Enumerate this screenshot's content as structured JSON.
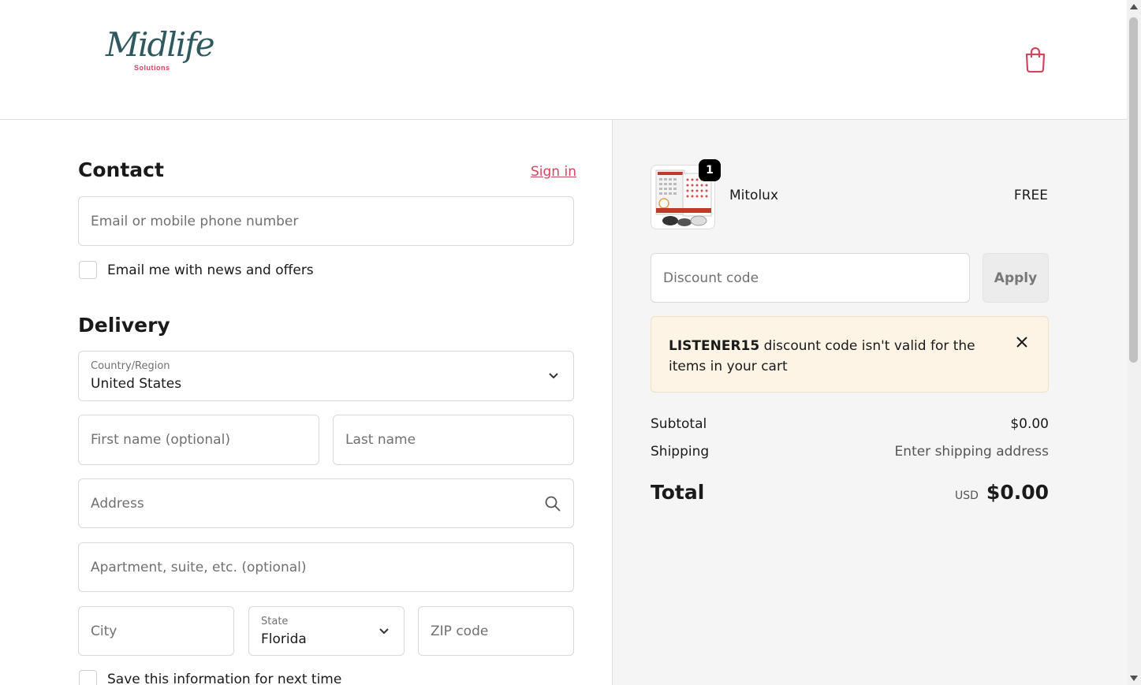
{
  "brand": {
    "logo_script": "Midlife",
    "logo_sub": "Solutions"
  },
  "icons": {
    "cart": "shopping-bag-icon",
    "chevron": "chevron-down-icon",
    "search": "search-icon",
    "close": "close-icon"
  },
  "colors": {
    "accent": "#d2465e",
    "logo_teal": "#2f5960",
    "notice_bg": "#fdf4e6"
  },
  "contact": {
    "title": "Contact",
    "signin_label": "Sign in",
    "email_placeholder": "Email or mobile phone number",
    "news_label": "Email me with news and offers"
  },
  "delivery": {
    "title": "Delivery",
    "country_label": "Country/Region",
    "country_value": "United States",
    "first_name_placeholder": "First name (optional)",
    "last_name_placeholder": "Last name",
    "address_placeholder": "Address",
    "apartment_placeholder": "Apartment, suite, etc. (optional)",
    "city_placeholder": "City",
    "state_label": "State",
    "state_value": "Florida",
    "zip_placeholder": "ZIP code",
    "save_label": "Save this information for next time"
  },
  "summary": {
    "product": {
      "name": "Mitolux",
      "price": "FREE",
      "quantity": "1"
    },
    "discount_placeholder": "Discount code",
    "apply_label": "Apply",
    "alert": {
      "code": "LISTENER15",
      "message": " discount code isn't valid for the items in your cart"
    },
    "subtotal_label": "Subtotal",
    "subtotal_value": "$0.00",
    "shipping_label": "Shipping",
    "shipping_value": "Enter shipping address",
    "total_label": "Total",
    "currency": "USD",
    "total_value": "$0.00"
  }
}
